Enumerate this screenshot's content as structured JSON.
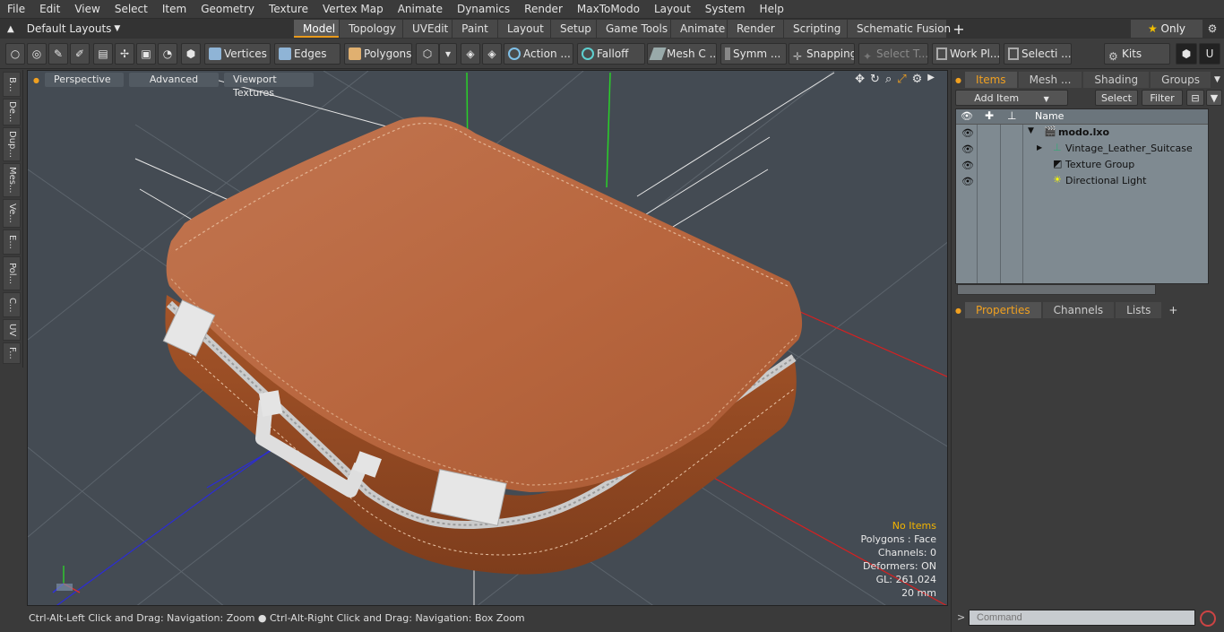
{
  "menu": [
    "File",
    "Edit",
    "View",
    "Select",
    "Item",
    "Geometry",
    "Texture",
    "Vertex Map",
    "Animate",
    "Dynamics",
    "Render",
    "MaxToModo",
    "Layout",
    "System",
    "Help"
  ],
  "layout_selector": "Default Layouts",
  "mode_tabs": [
    "Model",
    "Topology",
    "UVEdit",
    "Paint",
    "Layout",
    "Setup",
    "Game Tools",
    "Animate",
    "Render",
    "Scripting",
    "Schematic Fusion"
  ],
  "active_mode_tab": "Model",
  "only_label": "Only",
  "toolbar": {
    "vertices": "Vertices",
    "edges": "Edges",
    "polygons": "Polygons",
    "action": "Action ...",
    "falloff": "Falloff",
    "mesh": "Mesh C ...",
    "symm": "Symm ...",
    "snapping": "Snapping",
    "select_t": "Select T...",
    "work_pl": "Work Pl...",
    "selecti": "Selecti ...",
    "kits": "Kits"
  },
  "left_tabs": [
    "B...",
    "De...",
    "Dup...",
    "Mes...",
    "Ve...",
    "E...",
    "Pol...",
    "C...",
    "UV",
    "F..."
  ],
  "viewport": {
    "perspective": "Perspective",
    "advanced": "Advanced",
    "textures": "Viewport Textures",
    "stats": {
      "items": "No Items",
      "polygons": "Polygons : Face",
      "channels": "Channels: 0",
      "deformers": "Deformers: ON",
      "gl": "GL: 261,024",
      "scale": "20 mm"
    }
  },
  "status_bar": "Ctrl-Alt-Left Click and Drag: Navigation: Zoom ● Ctrl-Alt-Right Click and Drag: Navigation: Box Zoom",
  "items_panel": {
    "tabs": [
      "Items",
      "Mesh ...",
      "Shading",
      "Groups"
    ],
    "active_tab": "Items",
    "add_item": "Add Item",
    "select": "Select",
    "filter": "Filter",
    "column_name": "Name",
    "tree": [
      {
        "label": "modo.lxo",
        "icon": "scene-icon",
        "bold": true
      },
      {
        "label": "Vintage_Leather_Suitcase",
        "icon": "mesh-icon",
        "bold": false
      },
      {
        "label": "Texture Group",
        "icon": "texture-group-icon",
        "bold": false
      },
      {
        "label": "Directional Light",
        "icon": "light-icon",
        "bold": false
      }
    ]
  },
  "properties_panel": {
    "tabs": [
      "Properties",
      "Channels",
      "Lists"
    ],
    "active_tab": "Properties",
    "command_placeholder": "Command"
  },
  "colors": {
    "accent": "#e89a1c",
    "viewport_bg": "#444b53",
    "suitcase": "#b8663e",
    "highlight": "#f3b400"
  }
}
